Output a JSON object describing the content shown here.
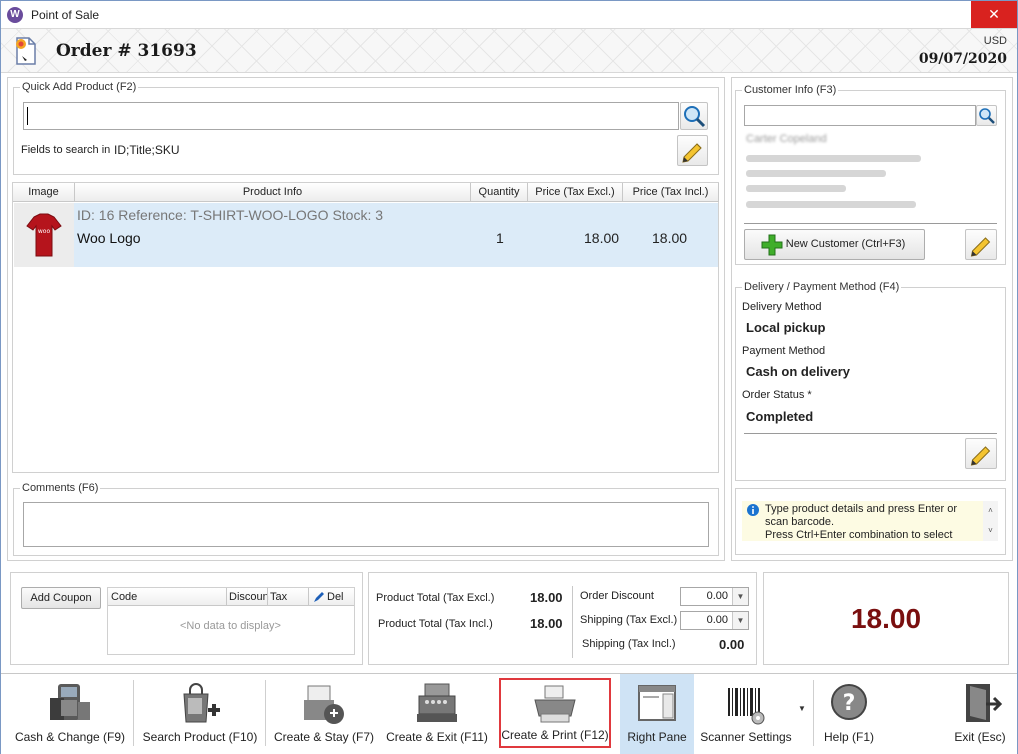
{
  "window": {
    "title": "Point of Sale",
    "app_icon": "W",
    "minimize": "–",
    "maximize": "☐",
    "close": "✕"
  },
  "header": {
    "order_title": "Order # 31693",
    "currency": "USD",
    "date": "09/07/2020"
  },
  "quick_add": {
    "group_title": "Quick Add Product (F2)",
    "search_value": "",
    "fields_label": "Fields to search in",
    "fields_value": "ID;Title;SKU"
  },
  "product_grid": {
    "columns": [
      "Image",
      "Product Info",
      "Quantity",
      "Price (Tax Excl.)",
      "Price (Tax Incl.)"
    ],
    "rows": [
      {
        "meta": "ID: 16 Reference: T-SHIRT-WOO-LOGO Stock: 3",
        "title": "Woo Logo",
        "image_text": "woo",
        "quantity": "1",
        "price_excl": "18.00",
        "price_incl": "18.00"
      }
    ]
  },
  "comments": {
    "group_title": "Comments (F6)",
    "value": ""
  },
  "customer": {
    "group_title": "Customer Info (F3)",
    "search_value": "",
    "name": "Carter Copeland",
    "new_customer_label": "New Customer (Ctrl+F3)"
  },
  "delivery": {
    "group_title": "Delivery / Payment Method (F4)",
    "delivery_label": "Delivery Method",
    "delivery_value": "Local pickup",
    "payment_label": "Payment Method",
    "payment_value": "Cash on delivery",
    "status_label": "Order Status *",
    "status_value": "Completed"
  },
  "hint": {
    "line1": "Type product details and press Enter or",
    "line2": "scan barcode.",
    "line3": "Press Ctrl+Enter combination to select"
  },
  "coupon": {
    "add_label": "Add Coupon",
    "columns": [
      "Code",
      "Discoun",
      "Tax",
      "Del"
    ],
    "empty": "<No data to display>"
  },
  "totals": {
    "product_total_excl_label": "Product Total (Tax Excl.)",
    "product_total_excl": "18.00",
    "product_total_incl_label": "Product Total (Tax Incl.)",
    "product_total_incl": "18.00",
    "order_discount_label": "Order Discount",
    "order_discount": "0.00",
    "shipping_excl_label": "Shipping (Tax Excl.)",
    "shipping_excl": "0.00",
    "shipping_incl_label": "Shipping (Tax Incl.)",
    "shipping_incl": "0.00",
    "grand_total": "18.00"
  },
  "toolbar": {
    "cash_change": "Cash & Change (F9)",
    "search_product": "Search Product (F10)",
    "create_stay": "Create & Stay (F7)",
    "create_exit": "Create & Exit (F11)",
    "create_print": "Create & Print (F12)",
    "right_pane": "Right Pane",
    "scanner_settings": "Scanner Settings",
    "help": "Help (F1)",
    "exit": "Exit (Esc)"
  },
  "colors": {
    "grand_total": "#7a0f0f",
    "selected_row": "#dcebf8",
    "highlight_border": "#e0393e",
    "right_pane_active": "#cfe3f5"
  }
}
